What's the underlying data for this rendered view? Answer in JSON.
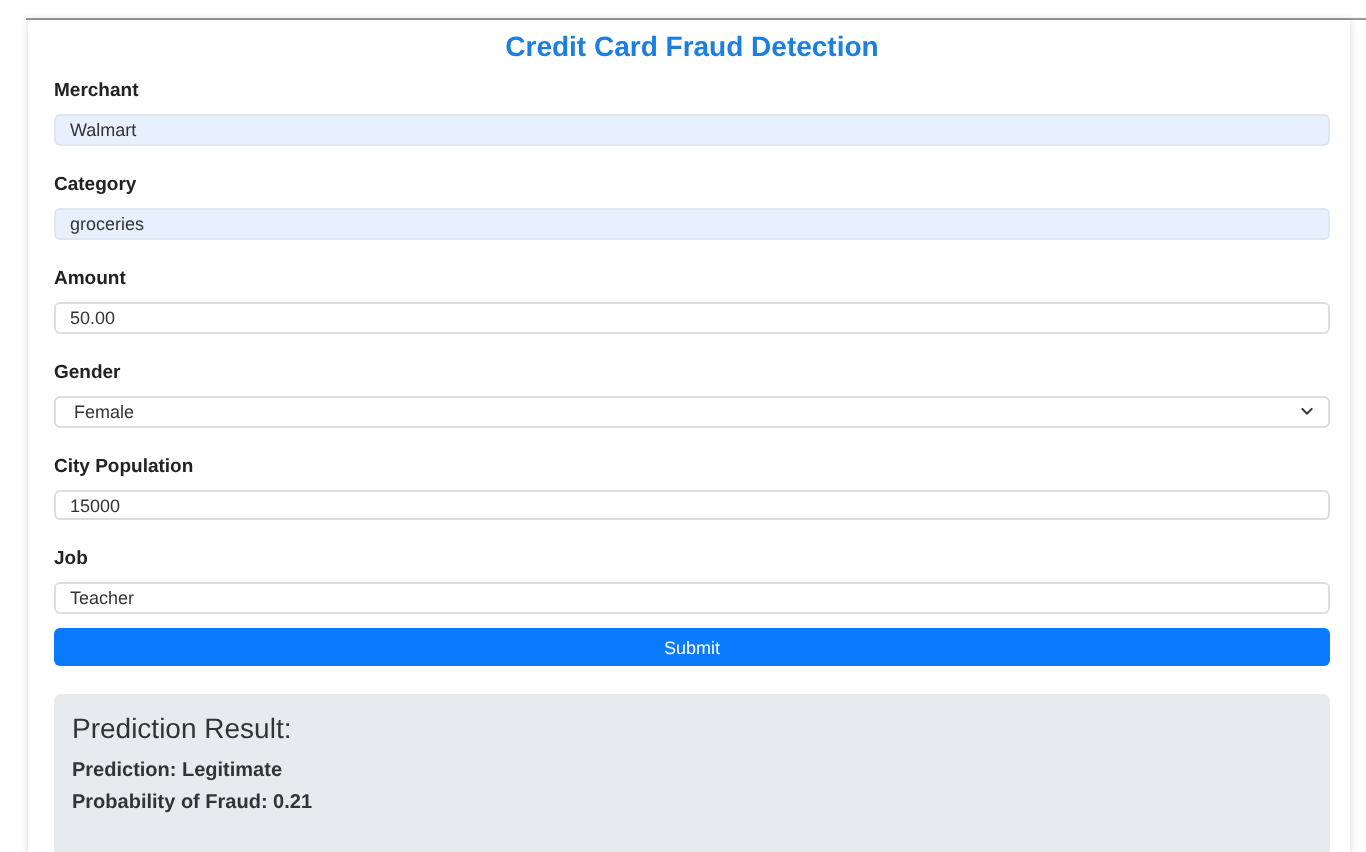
{
  "title": "Credit Card Fraud Detection",
  "fields": [
    {
      "label": "Merchant",
      "kind": "text",
      "value": "Walmart",
      "autofilled": true
    },
    {
      "label": "Category",
      "kind": "text",
      "value": "groceries",
      "autofilled": true
    },
    {
      "label": "Amount",
      "kind": "text",
      "value": "50.00",
      "autofilled": false
    },
    {
      "label": "Gender",
      "kind": "select",
      "value": "Female",
      "autofilled": false
    },
    {
      "label": "City Population",
      "kind": "text",
      "value": "15000",
      "autofilled": false
    },
    {
      "label": "Job",
      "kind": "text",
      "value": "Teacher",
      "autofilled": false
    }
  ],
  "submit": "Submit",
  "result": {
    "heading": "Prediction Result:",
    "lines": [
      "Prediction: Legitimate",
      "Probability of Fraud: 0.21"
    ]
  }
}
